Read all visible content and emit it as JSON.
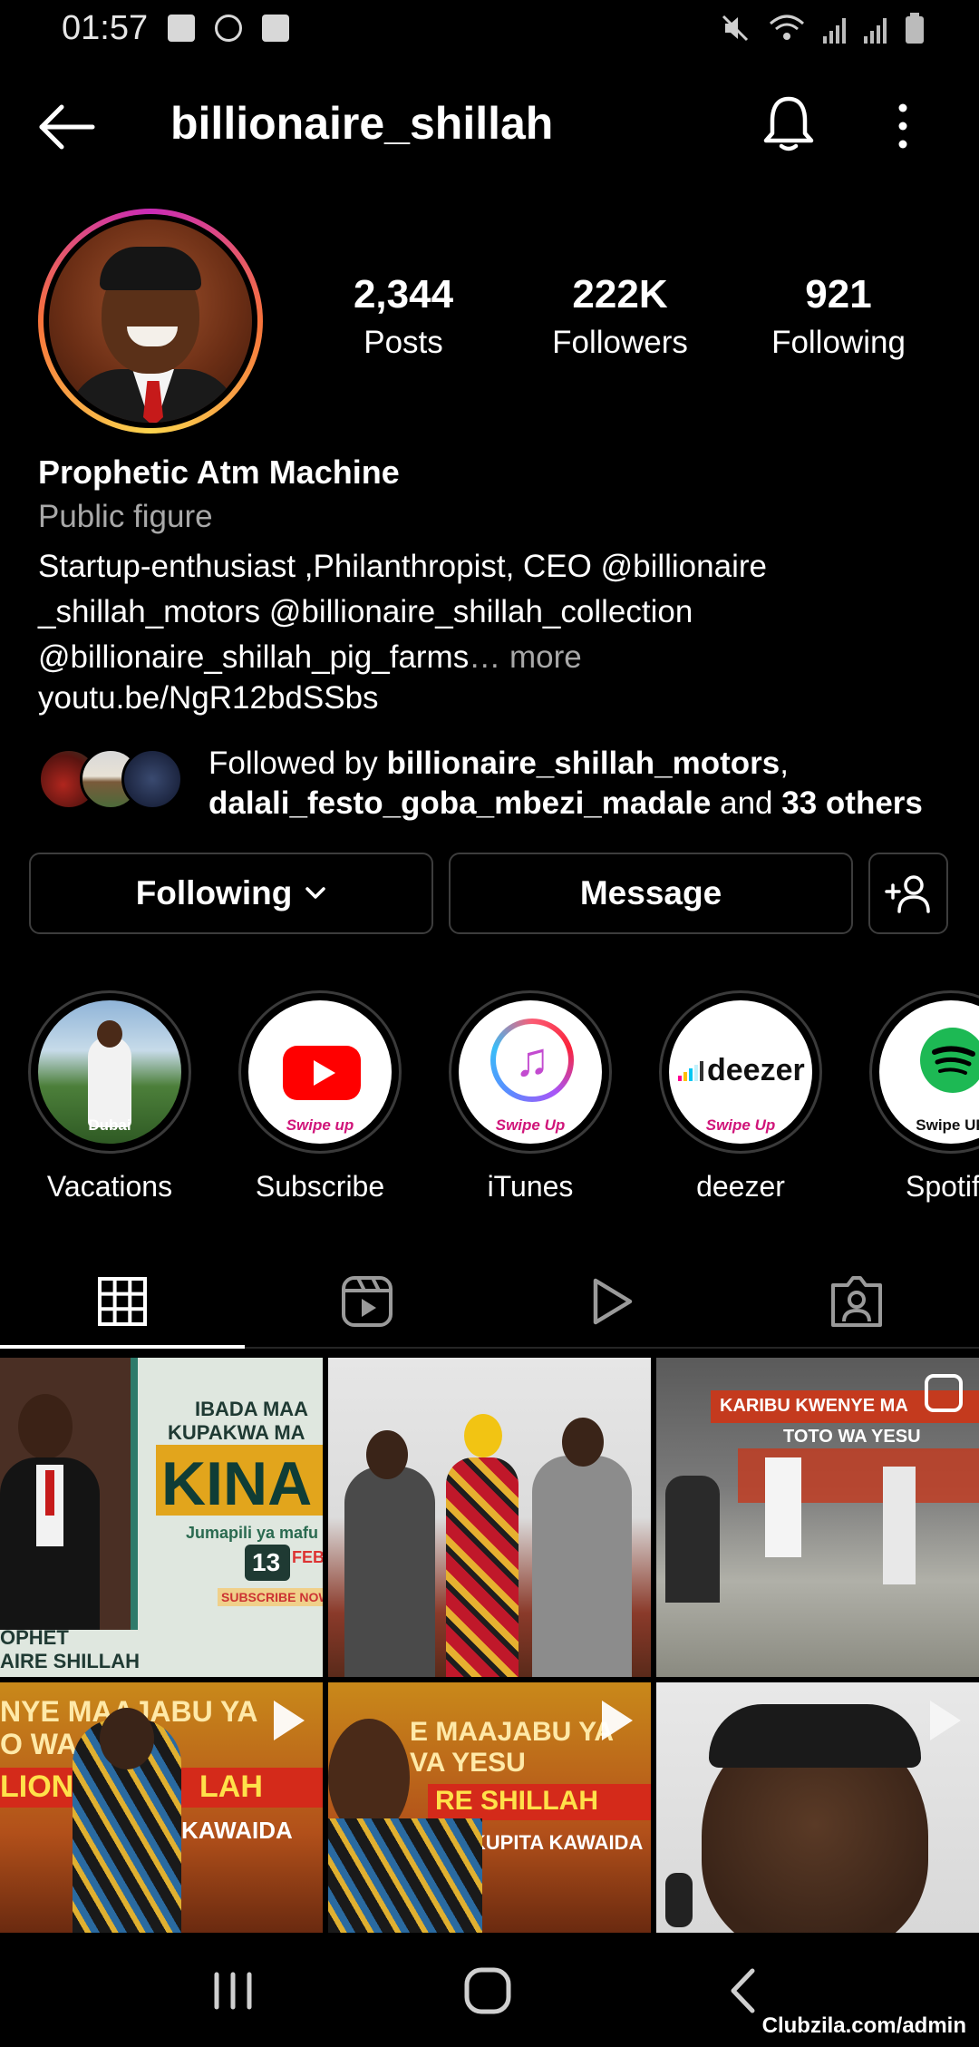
{
  "status_bar": {
    "time": "01:57"
  },
  "header": {
    "username": "billionaire_shillah"
  },
  "profile": {
    "stats": [
      {
        "value": "2,344",
        "label": "Posts"
      },
      {
        "value": "222K",
        "label": "Followers"
      },
      {
        "value": "921",
        "label": "Following"
      }
    ],
    "display_name": "Prophetic Atm Machine",
    "category": "Public figure",
    "bio_line1": "Startup-enthusiast ,Philanthropist, CEO @billionaire",
    "bio_line2": "_shillah_motors @billionaire_shillah_collection",
    "bio_line3": "@billionaire_shillah_pig_farms",
    "bio_more": "… more",
    "link": "youtu.be/NgR12bdSSbs",
    "followed_by_prefix": "Followed by ",
    "followed_by_user1": "billionaire_shillah_motors",
    "followed_by_sep": ",",
    "followed_by_user2": "dalali_festo_goba_mbezi_madale",
    "followed_by_and": " and ",
    "followed_by_others": "33 others"
  },
  "actions": {
    "following_label": "Following",
    "message_label": "Message"
  },
  "highlights": [
    {
      "label": "Vacations",
      "overlay": "Dubai"
    },
    {
      "label": "Subscribe",
      "overlay": "Swipe up"
    },
    {
      "label": "iTunes",
      "overlay": "Swipe Up"
    },
    {
      "label": "deezer",
      "overlay": "Swipe Up",
      "brand": "deezer"
    },
    {
      "label": "Spotif",
      "overlay": "Swipe UP"
    }
  ],
  "posts": {
    "p1_text_a": "IBADA MAA",
    "p1_text_b": "KUPAKWA MA",
    "p1_text_c": "KINA",
    "p1_text_d": "Jumapili ya mafu",
    "p1_text_e": "13",
    "p1_text_f": "FEB",
    "p1_text_g": "SUBSCRIBE NOW",
    "p1_text_h": "OPHET",
    "p1_text_i": "AIRE SHILLAH",
    "p3_text_a": "KARIBU KWENYE MA",
    "p3_text_b": "TOTO WA YESU",
    "p4_text_a": "NYE MAAJABU YA",
    "p4_text_b": "O WA YE",
    "p4_text_c": "LIONAIRE",
    "p4_text_d": "LAH",
    "p4_text_e": "KAWAIDA",
    "p5_text_a": "E MAAJABU YA",
    "p5_text_b": "VA YESU",
    "p5_text_c": "RE SHILLAH",
    "p5_text_d": "RU KUPITA KAWAIDA"
  },
  "watermark": "Clubzila.com/admin",
  "colors": {
    "background": "#000000",
    "secondary_text": "#a8a8a8",
    "button_border": "#3d3d3d"
  }
}
